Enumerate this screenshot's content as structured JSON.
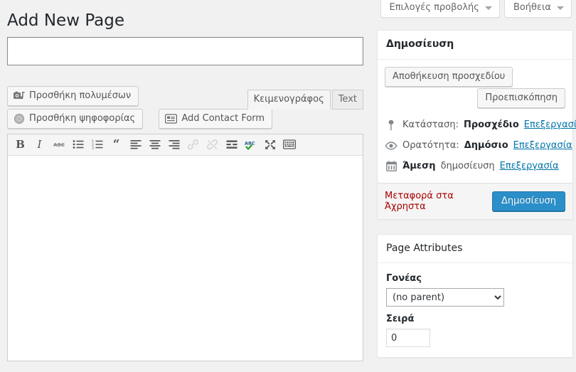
{
  "screen_meta": {
    "tabs": [
      {
        "label": "Επιλογές προβολής",
        "icon": "chevron-down-icon"
      },
      {
        "label": "Βοήθεια",
        "icon": "chevron-down-icon"
      }
    ]
  },
  "page": {
    "title": "Add New Page"
  },
  "title_field": {
    "value": "",
    "placeholder": ""
  },
  "editor": {
    "media_buttons": [
      {
        "label": "Προσθήκη πολυμέσων",
        "icon": "add-media-icon"
      },
      {
        "label": "Προσθήκη ψηφοφορίας",
        "icon": "poll-icon"
      },
      {
        "label": "Add Contact Form",
        "icon": "contact-form-icon"
      }
    ],
    "tabs": [
      {
        "label": "Κειμενογράφος",
        "active": true
      },
      {
        "label": "Text",
        "active": false
      }
    ],
    "toolbar": [
      {
        "name": "bold",
        "glyph": "B",
        "disabled": false
      },
      {
        "name": "italic",
        "glyph": "I",
        "disabled": false
      },
      {
        "name": "strikethrough",
        "glyph": "ABC",
        "disabled": false
      },
      {
        "name": "bullet-list",
        "glyph": "",
        "disabled": false
      },
      {
        "name": "numbered-list",
        "glyph": "",
        "disabled": false
      },
      {
        "name": "blockquote",
        "glyph": "“",
        "disabled": false
      },
      {
        "name": "align-left",
        "glyph": "",
        "disabled": false
      },
      {
        "name": "align-center",
        "glyph": "",
        "disabled": false
      },
      {
        "name": "align-right",
        "glyph": "",
        "disabled": false
      },
      {
        "name": "insert-link",
        "glyph": "",
        "disabled": true
      },
      {
        "name": "unlink",
        "glyph": "",
        "disabled": true
      },
      {
        "name": "insert-more-tag",
        "glyph": "",
        "disabled": false
      },
      {
        "name": "spellcheck",
        "glyph": "ABC",
        "disabled": false
      },
      {
        "name": "fullscreen",
        "glyph": "",
        "disabled": false
      },
      {
        "name": "toolbar-toggle",
        "glyph": "",
        "disabled": false
      }
    ],
    "content": ""
  },
  "publish_box": {
    "heading": "Δημοσίευση",
    "save_draft_label": "Αποθήκευση προσχεδίου",
    "preview_label": "Προεπισκόπηση",
    "status": {
      "icon": "pin-icon",
      "label": "Κατάσταση:",
      "value": "Προσχέδιο",
      "edit_label": "Επεξεργασία"
    },
    "visibility": {
      "icon": "eye-icon",
      "label": "Ορατότητα:",
      "value": "Δημόσιο",
      "edit_label": "Επεξεργασία"
    },
    "schedule": {
      "icon": "calendar-icon",
      "value": "Άμεση",
      "label": "δημοσίευση",
      "edit_label": "Επεξεργασία"
    },
    "trash_label": "Μεταφορά στα Άχρηστα",
    "publish_label": "Δημοσίευση",
    "publish_button_color": "#2b8fc9",
    "trash_link_color": "#a00"
  },
  "page_attributes": {
    "heading": "Page Attributes",
    "parent_label": "Γονέας",
    "parent_value": "(no parent)",
    "parent_options": [
      "(no parent)"
    ],
    "order_label": "Σειρά",
    "order_value": "0"
  }
}
